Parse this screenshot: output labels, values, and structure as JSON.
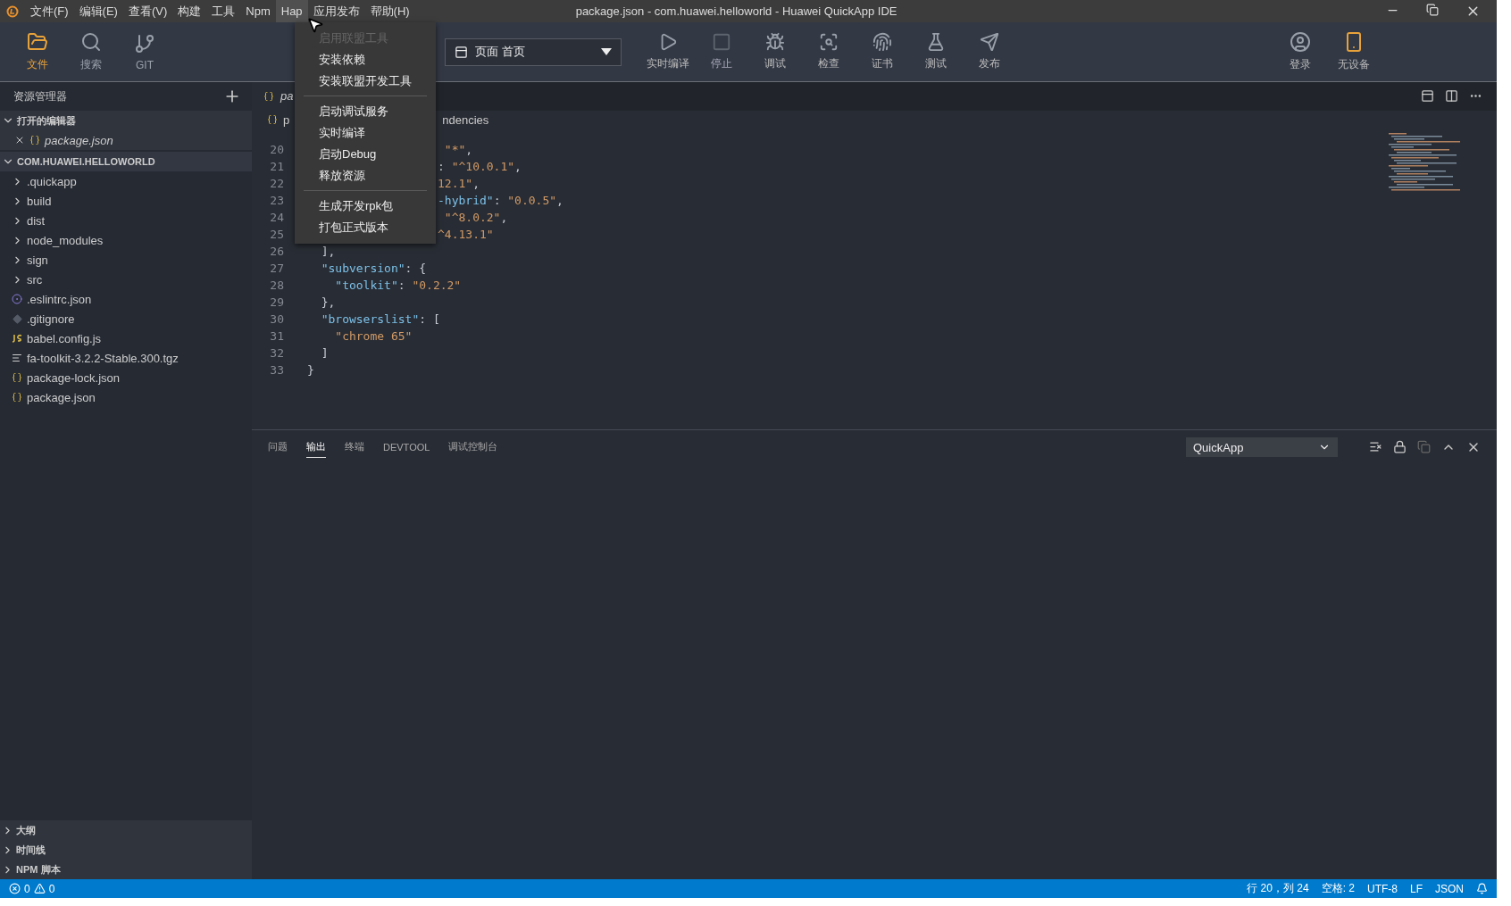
{
  "menubar": {
    "items": [
      {
        "label": "文件(F)",
        "selected": false
      },
      {
        "label": "编辑(E)",
        "selected": false
      },
      {
        "label": "查看(V)",
        "selected": false
      },
      {
        "label": "构建",
        "selected": false
      },
      {
        "label": "工具",
        "selected": false
      },
      {
        "label": "Npm",
        "selected": false
      },
      {
        "label": "Hap",
        "selected": true
      },
      {
        "label": "应用发布",
        "selected": false
      },
      {
        "label": "帮助(H)",
        "selected": false
      }
    ],
    "title": "package.json - com.huawei.helloworld - Huawei QuickApp IDE"
  },
  "hap_menu": [
    {
      "kind": "item",
      "label": "启用联盟工具",
      "disabled": true
    },
    {
      "kind": "item",
      "label": "安装依赖",
      "disabled": false
    },
    {
      "kind": "item",
      "label": "安装联盟开发工具",
      "disabled": false
    },
    {
      "kind": "separator"
    },
    {
      "kind": "item",
      "label": "启动调试服务",
      "disabled": false
    },
    {
      "kind": "item",
      "label": "实时编译",
      "disabled": false
    },
    {
      "kind": "item",
      "label": "启动Debug",
      "disabled": false
    },
    {
      "kind": "item",
      "label": "释放资源",
      "disabled": false
    },
    {
      "kind": "separator"
    },
    {
      "kind": "item",
      "label": "生成开发rpk包",
      "disabled": false
    },
    {
      "kind": "item",
      "label": "打包正式版本",
      "disabled": false
    }
  ],
  "toolbar": {
    "left": [
      {
        "kind": "files",
        "label": "文件",
        "selected": true
      },
      {
        "kind": "search",
        "label": "搜索",
        "selected": false
      },
      {
        "kind": "git",
        "label": "GIT",
        "selected": false
      }
    ],
    "page_select": {
      "value": "页面 首页"
    },
    "actions": [
      {
        "kind": "compile",
        "label": "实时编译",
        "disabled": false
      },
      {
        "kind": "stop",
        "label": "停止",
        "disabled": true
      },
      {
        "kind": "debug",
        "label": "调试",
        "disabled": false
      },
      {
        "kind": "inspect",
        "label": "检查",
        "disabled": false
      },
      {
        "kind": "cert",
        "label": "证书",
        "disabled": false
      },
      {
        "kind": "test",
        "label": "测试",
        "disabled": false
      },
      {
        "kind": "publish",
        "label": "发布",
        "disabled": false
      }
    ],
    "right": [
      {
        "kind": "login",
        "label": "登录"
      },
      {
        "kind": "device",
        "label": "无设备"
      }
    ]
  },
  "sidebar": {
    "title": "资源管理器",
    "open_editors": {
      "label": "打开的编辑器",
      "expanded": true,
      "items": [
        {
          "label": "package.json"
        }
      ]
    },
    "project": {
      "label": "COM.HUAWEI.HELLOWORLD",
      "expanded": true,
      "children": [
        {
          "kind": "folder",
          "label": ".quickapp"
        },
        {
          "kind": "folder",
          "label": "build"
        },
        {
          "kind": "folder",
          "label": "dist"
        },
        {
          "kind": "folder",
          "label": "node_modules"
        },
        {
          "kind": "folder",
          "label": "sign"
        },
        {
          "kind": "folder",
          "label": "src"
        },
        {
          "kind": "eslint",
          "label": ".eslintrc.json"
        },
        {
          "kind": "git",
          "label": ".gitignore"
        },
        {
          "kind": "js",
          "label": "babel.config.js"
        },
        {
          "kind": "archive",
          "label": "fa-toolkit-3.2.2-Stable.300.tgz"
        },
        {
          "kind": "json",
          "label": "package-lock.json"
        },
        {
          "kind": "json",
          "label": "package.json"
        }
      ]
    },
    "bottom_sections": [
      {
        "label": "大纲",
        "expanded": false
      },
      {
        "label": "时间线",
        "expanded": false
      },
      {
        "label": "NPM 脚本",
        "expanded": false
      }
    ]
  },
  "editor": {
    "tab": {
      "label": "pa",
      "selected": true
    },
    "breadcrumb": [
      "p",
      "ndencies"
    ],
    "lines": [
      {
        "number": "20",
        "kind": "covered",
        "tokens": [
          {
            "kind": "string",
            "text": " \"*\""
          },
          {
            "kind": "punct",
            "text": ","
          }
        ]
      },
      {
        "number": "21",
        "kind": "covered",
        "tokens": [
          {
            "kind": "punct",
            "text": ": "
          },
          {
            "kind": "string",
            "text": "\"^10.0.1\""
          },
          {
            "kind": "punct",
            "text": ","
          }
        ]
      },
      {
        "number": "22",
        "kind": "covered",
        "tokens": [
          {
            "kind": "string",
            "text": "12.1\""
          },
          {
            "kind": "punct",
            "text": ","
          }
        ]
      },
      {
        "number": "23",
        "kind": "covered",
        "tokens": [
          {
            "kind": "key",
            "text": "-hybrid\""
          },
          {
            "kind": "punct",
            "text": ": "
          },
          {
            "kind": "string",
            "text": "\"0.0.5\""
          },
          {
            "kind": "punct",
            "text": ","
          }
        ]
      },
      {
        "number": "24",
        "kind": "covered",
        "tokens": [
          {
            "kind": "string",
            "text": " \"^8.0.2\""
          },
          {
            "kind": "punct",
            "text": ","
          }
        ]
      },
      {
        "number": "25",
        "kind": "covered",
        "tokens": [
          {
            "kind": "string",
            "text": "^4.13.1\""
          }
        ]
      },
      {
        "number": "26",
        "kind": "full",
        "tokens": [
          {
            "kind": "punct",
            "text": "  ],"
          }
        ]
      },
      {
        "number": "27",
        "kind": "full",
        "tokens": [
          {
            "kind": "key",
            "text": "  \"subversion\""
          },
          {
            "kind": "punct",
            "text": ": {"
          }
        ]
      },
      {
        "number": "28",
        "kind": "full",
        "tokens": [
          {
            "kind": "key",
            "text": "    \"toolkit\""
          },
          {
            "kind": "punct",
            "text": ": "
          },
          {
            "kind": "string",
            "text": "\"0.2.2\""
          }
        ]
      },
      {
        "number": "29",
        "kind": "full",
        "tokens": [
          {
            "kind": "punct",
            "text": "  },"
          }
        ]
      },
      {
        "number": "30",
        "kind": "full",
        "tokens": [
          {
            "kind": "key",
            "text": "  \"browserslist\""
          },
          {
            "kind": "punct",
            "text": ": ["
          }
        ]
      },
      {
        "number": "31",
        "kind": "full",
        "tokens": [
          {
            "kind": "string",
            "text": "    \"chrome 65\""
          }
        ]
      },
      {
        "number": "32",
        "kind": "full",
        "tokens": [
          {
            "kind": "punct",
            "text": "  ]"
          }
        ]
      },
      {
        "number": "33",
        "kind": "full",
        "tokens": [
          {
            "kind": "punct",
            "text": "}"
          }
        ]
      }
    ]
  },
  "panel": {
    "tabs": [
      {
        "label": "问题",
        "selected": false
      },
      {
        "label": "输出",
        "selected": true
      },
      {
        "label": "终端",
        "selected": false
      },
      {
        "label": "DEVTOOL",
        "selected": false
      },
      {
        "label": "调试控制台",
        "selected": false
      }
    ],
    "channel": "QuickApp"
  },
  "status_bar": {
    "errors": "0",
    "warnings": "0",
    "right": [
      "行 20，列 24",
      "空格: 2",
      "UTF-8",
      "LF",
      "JSON"
    ]
  }
}
